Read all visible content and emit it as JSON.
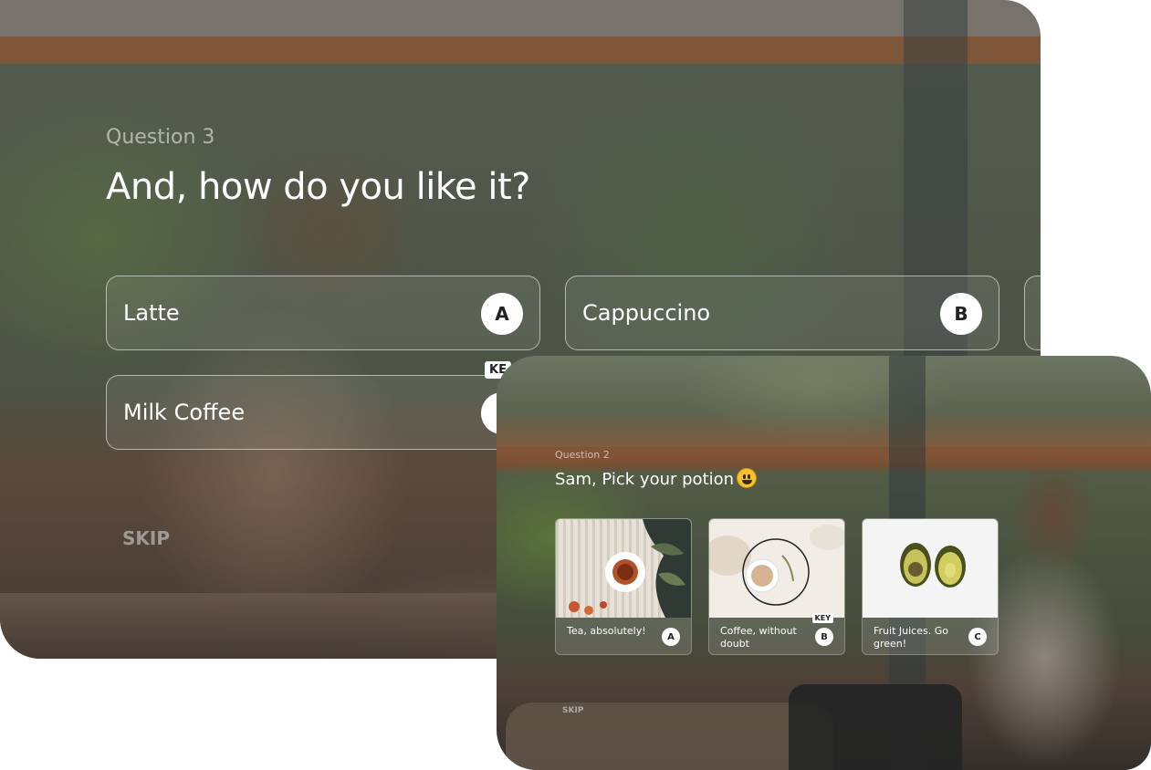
{
  "back_card": {
    "question_number": "Question 3",
    "question_text": "And, how do you like it?",
    "options": [
      {
        "label": "Latte",
        "key": "A"
      },
      {
        "label": "Cappuccino",
        "key": "B"
      },
      {
        "label": "Milk Coffee",
        "key": ""
      }
    ],
    "key_hint": "KE",
    "skip_label": "SKIP"
  },
  "front_card": {
    "question_number": "Question 2",
    "question_text": "Sam, Pick your potion",
    "emoji": "grinning-face-icon",
    "options": [
      {
        "label": "Tea, absolutely!",
        "key": "A",
        "image": "tea-photo"
      },
      {
        "label": "Coffee, without doubt",
        "key": "B",
        "image": "coffee-photo"
      },
      {
        "label": "Fruit Juices. Go green!",
        "key": "C",
        "image": "avocado-photo"
      }
    ],
    "key_hint": "KEY",
    "skip_label": "SKIP"
  }
}
